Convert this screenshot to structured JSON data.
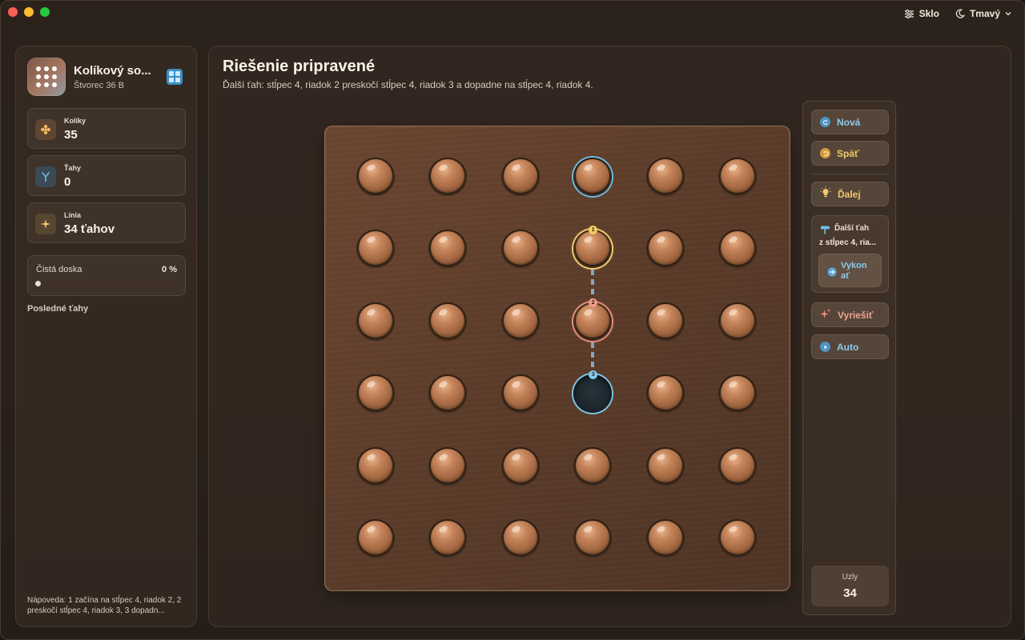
{
  "topbar": {
    "material_label": "Sklo",
    "theme_label": "Tmavý"
  },
  "sidebar": {
    "app_title": "Kolíkový so...",
    "app_subtitle": "Štvorec 36 B",
    "stats": [
      {
        "label": "Kolíky",
        "value": "35",
        "icon": "pegs-icon",
        "color": "#f2b75f"
      },
      {
        "label": "Ťahy",
        "value": "0",
        "icon": "branch-icon",
        "color": "#6fbfe6"
      },
      {
        "label": "Línia",
        "value": "34 ťahov",
        "icon": "sparkle-icon",
        "color": "#f2c86b"
      }
    ],
    "progress": {
      "label": "Čistá doska",
      "percent_text": "0 %",
      "fraction": 0.0
    },
    "recent_title": "Posledné ťahy",
    "hint": "Nápoveda: 1 začína na stĺpec 4, riadok 2, 2 preskočí stĺpec 4, riadok 3, 3 dopadn..."
  },
  "main": {
    "title": "Riešenie pripravené",
    "subtitle": "Ďalší ťah: stĺpec 4, riadok 2 preskočí stĺpec 4, riadok 3 a dopadne na stĺpec 4, riadok 4."
  },
  "board": {
    "columns": 6,
    "rows": 6,
    "empty_cells": [
      [
        3,
        3
      ]
    ],
    "highlight_cells": {
      "target": [
        0,
        3
      ],
      "from": [
        1,
        3
      ],
      "over": [
        2,
        3
      ],
      "to": [
        3,
        3
      ]
    },
    "badges": {
      "from": "1",
      "over": "2",
      "to": "3"
    }
  },
  "actions": {
    "new": "Nová",
    "undo": "Späť",
    "next": "Ďalej",
    "next_move_title": "Ďalší ťah",
    "next_move_text": "z stĺpec 4, ria...",
    "execute": "Vykon ať",
    "solve": "Vyriešiť",
    "auto": "Auto",
    "nodes_label": "Uzly",
    "nodes_value": "34"
  },
  "colors": {
    "accent_blue": "#6fbfe6",
    "accent_yellow": "#f2c86b",
    "accent_red": "#ef8f7c"
  }
}
